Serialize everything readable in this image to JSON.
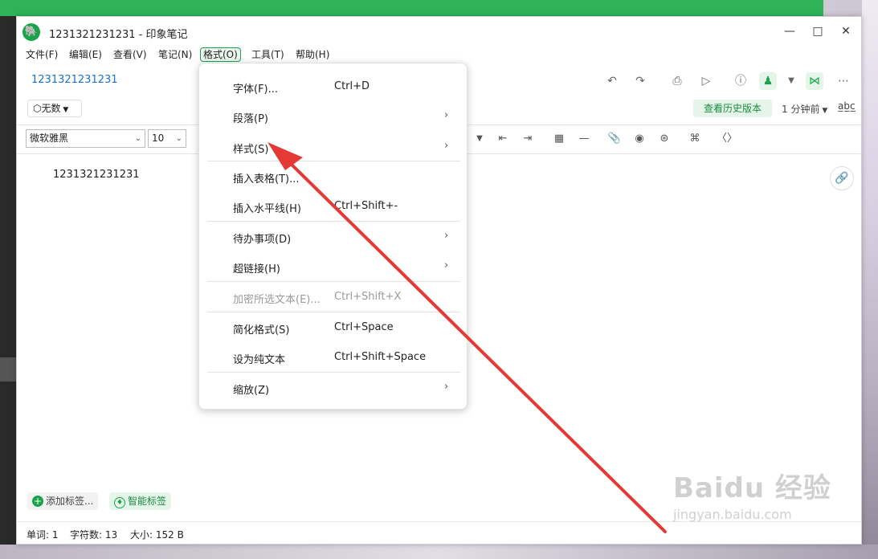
{
  "window": {
    "title": "1231321231231 - 印象笔记"
  },
  "menubar": {
    "items": [
      "文件(F)",
      "编辑(E)",
      "查看(V)",
      "笔记(N)",
      "格式(O)",
      "工具(T)",
      "帮助(H)"
    ]
  },
  "note_header": {
    "notebook": "1231321231231",
    "tag_select": "无数",
    "history_button": "查看历史版本",
    "time_ago": "1 分钟前"
  },
  "format_toolbar": {
    "font": "微软雅黑",
    "size": "10"
  },
  "note": {
    "body_text": "1231321231231"
  },
  "footer_tags": {
    "add_tag": "添加标签...",
    "smart_tag": "智能标签"
  },
  "statusbar": {
    "words": "单词:  1",
    "chars": "字符数:  13",
    "size": "大小:  152 B"
  },
  "format_menu": {
    "items": [
      {
        "label": "字体(F)...",
        "shortcut": "Ctrl+D",
        "submenu": false,
        "enabled": true
      },
      {
        "label": "段落(P)",
        "shortcut": "",
        "submenu": true,
        "enabled": true
      },
      {
        "label": "样式(S)",
        "shortcut": "",
        "submenu": true,
        "enabled": true
      },
      {
        "label": "插入表格(T)...",
        "shortcut": "",
        "submenu": false,
        "enabled": true
      },
      {
        "label": "插入水平线(H)",
        "shortcut": "Ctrl+Shift+-",
        "submenu": false,
        "enabled": true
      },
      {
        "label": "待办事项(D)",
        "shortcut": "",
        "submenu": true,
        "enabled": true
      },
      {
        "label": "超链接(H)",
        "shortcut": "",
        "submenu": true,
        "enabled": true
      },
      {
        "label": "加密所选文本(E)...",
        "shortcut": "Ctrl+Shift+X",
        "submenu": false,
        "enabled": false
      },
      {
        "label": "简化格式(S)",
        "shortcut": "Ctrl+Space",
        "submenu": false,
        "enabled": true
      },
      {
        "label": "设为纯文本",
        "shortcut": "Ctrl+Shift+Space",
        "submenu": false,
        "enabled": true
      },
      {
        "label": "缩放(Z)",
        "shortcut": "",
        "submenu": true,
        "enabled": true
      }
    ]
  },
  "watermark": {
    "brand": "Baidu 经验",
    "url": "jingyan.baidu.com"
  },
  "colors": {
    "accent": "#1aa34a",
    "arrow": "#e53935",
    "link": "#1a73c8"
  }
}
